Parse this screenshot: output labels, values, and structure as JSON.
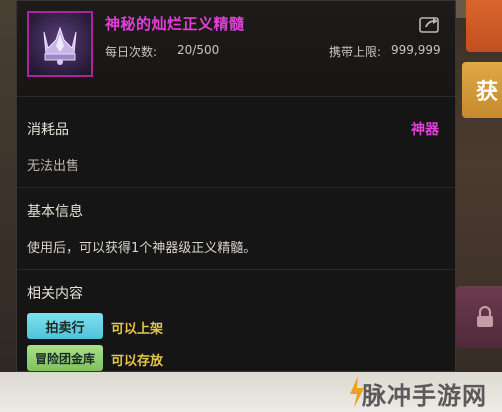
{
  "item": {
    "name": "神秘的灿烂正义精髓",
    "daily_label": "每日次数:",
    "daily_value": "20/500",
    "carry_label": "携带上限:",
    "carry_value": "999,999",
    "name_color": "#e23fd8"
  },
  "category": {
    "type": "消耗品",
    "grade": "神器",
    "trade_status": "无法出售"
  },
  "basic_info": {
    "title": "基本信息",
    "description": "使用后，可以获得1个神器级正义精髓。"
  },
  "related": {
    "title": "相关内容",
    "entries": [
      {
        "tag": "拍卖行",
        "desc": "可以上架",
        "tag_color": "#7fe0ef"
      },
      {
        "tag": "冒险团金库",
        "desc": "可以存放",
        "tag_color": "#a8e08a"
      }
    ]
  },
  "side": {
    "gold_button_label": "获"
  },
  "watermark": {
    "text": "脉冲手游网"
  },
  "icons": {
    "item": "crown-gem-icon",
    "share": "share-icon",
    "lock": "lock-icon",
    "watermark": "watermark-logo-icon"
  }
}
